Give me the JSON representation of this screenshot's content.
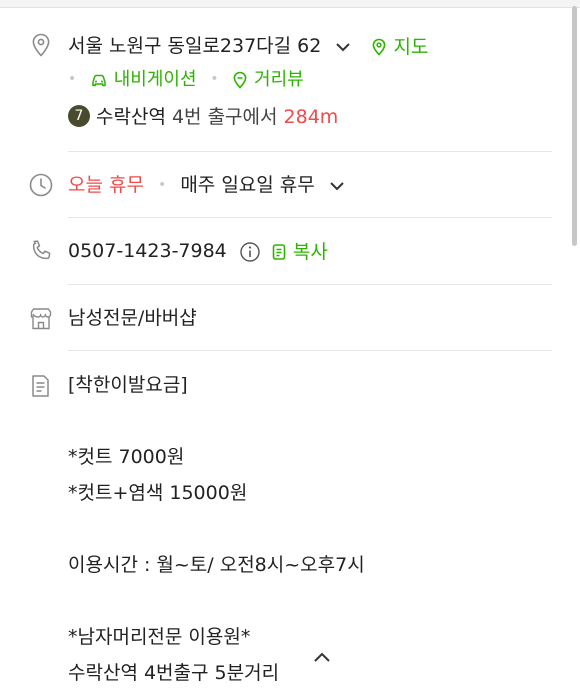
{
  "address": {
    "text": "서울 노원구 동일로237다길 62",
    "map_label": "지도",
    "navigation_label": "내비게이션",
    "streetview_label": "거리뷰",
    "subway_line_number": "7",
    "subway_station": "수락산역",
    "subway_exit_text": "4번 출구에서",
    "distance": "284m"
  },
  "hours": {
    "status": "오늘 휴무",
    "detail": "매주 일요일 휴무"
  },
  "phone": {
    "number": "0507-1423-7984",
    "copy_label": "복사"
  },
  "category": {
    "text": "남성전문/바버샵"
  },
  "description": {
    "text": "[착한이발요금]\n\n*컷트 7000원\n*컷트+염색 15000원\n\n이용시간 : 월~토/ 오전8시~오후7시\n\n*남자머리전문 이용원*\n수락산역 4번출구 5분거리"
  },
  "colors": {
    "accent_green": "#2db400",
    "alert_red": "#f04a4a",
    "icon_gray": "#8a8a8a",
    "subway_line_7": "#4a4a2f"
  },
  "icons": {
    "address": "location-pin-icon",
    "hours": "clock-icon",
    "phone": "phone-icon",
    "category": "store-icon",
    "description": "document-icon"
  }
}
